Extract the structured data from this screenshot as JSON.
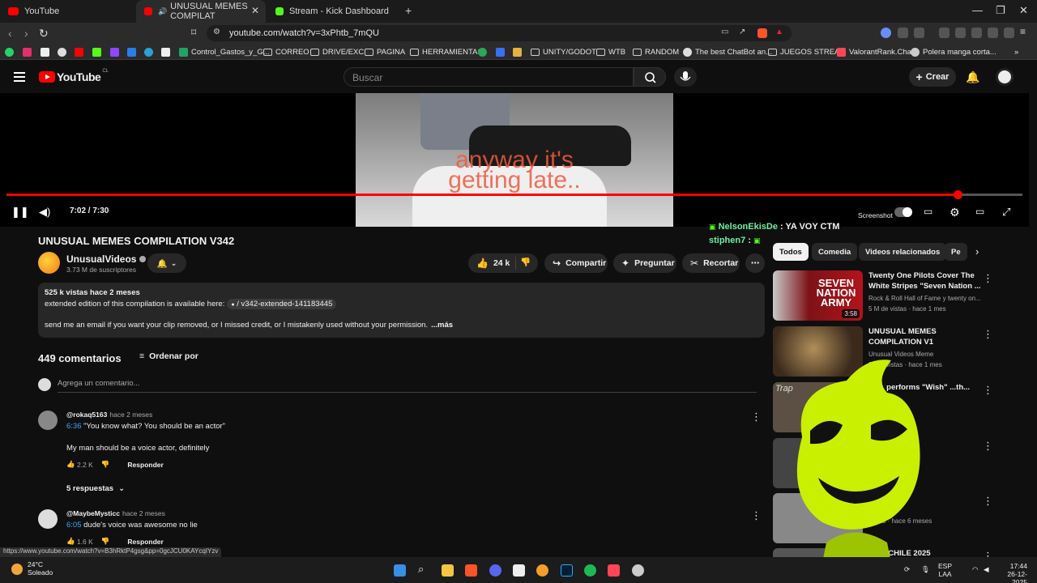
{
  "browser": {
    "tabs": [
      {
        "label": "YouTube",
        "color": "#ff0000"
      },
      {
        "label": "UNUSUAL MEMES COMPILAT",
        "color": "#ff0000"
      },
      {
        "label": "Stream - Kick Dashboard",
        "color": "#53fc18"
      }
    ],
    "url": "youtube.com/watch?v=3xPhtb_7mQU",
    "bookmarks": [
      "Control_Gastos_y_G...",
      "CORREO",
      "DRIVE/EXC",
      "PAGINA",
      "HERRAMIENTAS",
      "UNITY/GODOT",
      "WTB",
      "RANDOM",
      "The best ChatBot an...",
      "JUEGOS STREAM",
      "ValorantRank.Chat",
      "Polera manga corta..."
    ],
    "status_url": "https://www.youtube.com/watch?v=B3hRktP4gsg&pp=0gcJCU0KAYcqIYzv"
  },
  "header": {
    "logo": "YouTube",
    "country": "CL",
    "search_placeholder": "Buscar",
    "create_label": "Crear"
  },
  "player": {
    "subtitle_line1": "anyway it's",
    "subtitle_line2": "getting late..",
    "time": "7:02 / 7:30",
    "screenshot_label": "Screenshot",
    "progress": 0.936
  },
  "video": {
    "title": "UNUSUAL MEMES COMPILATION V342",
    "channel": "UnusualVideos",
    "subs": "3.73 M de suscriptores",
    "likes": "24 k",
    "share": "Compartir",
    "ask": "Preguntar",
    "clip": "Recortar"
  },
  "description": {
    "stats": "525 k vistas  hace 2 meses",
    "line2": "extended edition of this compilation is available here:",
    "link": "/ v342-extended-141183445",
    "line3": "send me an email if you want your clip removed, or I missed credit, or I mistakenly used without your permission.",
    "more": "...más"
  },
  "comments": {
    "count": "449 comentarios",
    "sort": "Ordenar por",
    "add_placeholder": "Agrega un comentario...",
    "reply_label": "Responder",
    "items": [
      {
        "author": "@rokaq5163",
        "when": "hace 2 meses",
        "timestamp": "6:36",
        "text": "\"You know what? You should be an actor\"",
        "text2": "My man should be a voice actor, definitely",
        "likes": "2.2 K",
        "replies": "5 respuestas"
      },
      {
        "author": "@MaybeMysticc",
        "when": "hace 2 meses",
        "timestamp": "6:05",
        "text": "dude's voice was awesome no lie",
        "likes": "1.6 K"
      }
    ]
  },
  "chat": {
    "line1_user": "NelsonEkisDe",
    "line1_sep": " : ",
    "line1_msg": "YA VOY CTM",
    "line2_user": "stiphen7",
    "line2_sep": " : "
  },
  "chips": [
    "Todos",
    "Comedia",
    "Videos relacionados",
    "Pe"
  ],
  "recommendations": [
    {
      "title": "Twenty One Pilots Cover The White Stripes \"Seven Nation ...",
      "meta1": "Rock & Roll Hall of Fame",
      "meta1b": "y twenty on...",
      "meta2": "5 M de vistas · hace 1 mes",
      "duration": "3:58",
      "thumb_text": "SEVEN NATION ARMY"
    },
    {
      "title": "UNUSUAL MEMES COMPILATION V1",
      "meta1": "Unusual Videos Meme",
      "meta2": "966 k vistas · hace 1 mes"
    },
    {
      "title": "Tri... performs \"Wish\" ...th... estra | ...",
      "meta1": "...",
      "meta2": "...hace 6 años",
      "thumb_text": "Trap"
    },
    {
      "title": "...ME? FT.",
      "meta1": "",
      "meta2": "... 3 semanas"
    },
    {
      "title": "",
      "meta1": "",
      "meta2": "...stas · hace 6 meses"
    },
    {
      "title": "...ND CHILE 2025",
      "meta1": "",
      "meta2": ""
    }
  ],
  "taskbar": {
    "temp": "24°C",
    "weather": "Soleado",
    "lang1": "ESP",
    "lang2": "LAA",
    "time": "17:44",
    "date": "26-12-2025"
  }
}
